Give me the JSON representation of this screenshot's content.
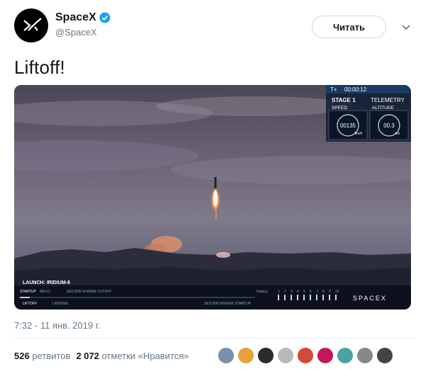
{
  "account": {
    "display_name": "SpaceX",
    "handle": "@SpaceX",
    "avatar_icon": "spacex-x-logo-icon",
    "verified_icon": "verified-badge-icon"
  },
  "follow_button": {
    "label": "Читать"
  },
  "menu_icon": "chevron-down-icon",
  "tweet": {
    "text": "Liftoff!"
  },
  "video_overlay": {
    "timer_prefix": "T+",
    "timer": "00:00:12",
    "stage": "STAGE 1",
    "telemetry": "TELEMETRY",
    "speed_label": "SPEED",
    "altitude_label": "ALTITUDE",
    "speed_value": "00135",
    "speed_unit": "km/h",
    "altitude_value": "00.3",
    "altitude_unit": "km",
    "launch_label": "LAUNCH: IRIDIUM-8",
    "timeline_upper": [
      "STARTUP",
      "MECO",
      "SECOND ENGINE CUTOFF"
    ],
    "timeline_lower": [
      "LIFTOFF",
      "LANDING",
      "SECOND ENGINE STARTUP"
    ],
    "deploy_label": "Deploy",
    "deploy_numbers": [
      "1",
      "2",
      "3",
      "4",
      "5",
      "6",
      "7",
      "8",
      "9",
      "10"
    ],
    "brand": "SPACEX"
  },
  "timestamp": "7:32 - 11 янв. 2019 г.",
  "stats": {
    "retweets_count": "526",
    "retweets_label": "ретвитов",
    "likes_count": "2 072",
    "likes_label": "отметки «Нравится»"
  },
  "liker_avatars": [
    {
      "name": "liker-avatar-1",
      "color": "#7a8fa8"
    },
    {
      "name": "liker-avatar-2",
      "color": "#e8a03a"
    },
    {
      "name": "liker-avatar-3",
      "color": "#2b2b2b"
    },
    {
      "name": "liker-avatar-4",
      "color": "#b9b9b9"
    },
    {
      "name": "liker-avatar-5",
      "color": "#d24a3d"
    },
    {
      "name": "liker-avatar-6",
      "color": "#c2185b"
    },
    {
      "name": "liker-avatar-7",
      "color": "#4aa3a0"
    },
    {
      "name": "liker-avatar-8",
      "color": "#888888"
    },
    {
      "name": "liker-avatar-9",
      "color": "#444444"
    }
  ]
}
